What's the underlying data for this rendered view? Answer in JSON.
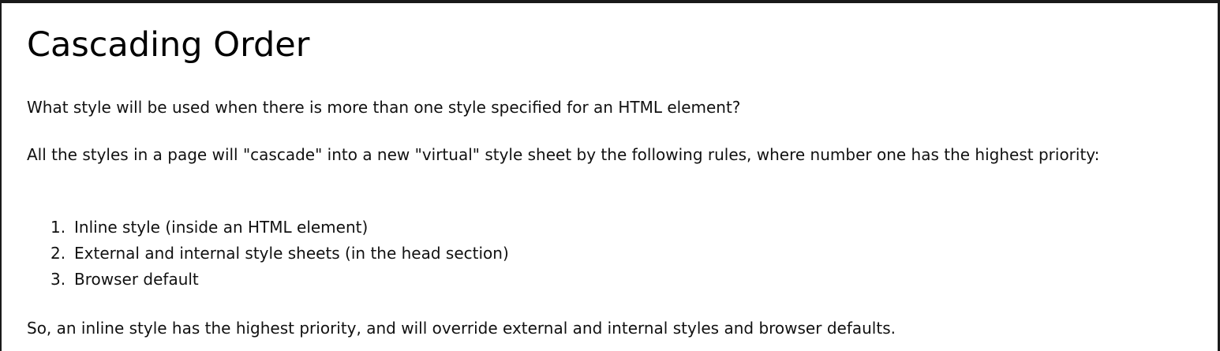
{
  "article": {
    "title": "Cascading Order",
    "question": "What style will be used when there is more than one style specified for an HTML element?",
    "intro": "All the styles in a page will \"cascade\" into a new \"virtual\" style sheet by the following rules, where number one has the highest priority:",
    "rules": [
      {
        "number": "1.",
        "text": "Inline style (inside an HTML element)"
      },
      {
        "number": "2.",
        "text": "External and internal style sheets (in the head section)"
      },
      {
        "number": "3.",
        "text": "Browser default"
      }
    ],
    "conclusion": "So, an inline style has the highest priority, and will override external and internal styles and browser defaults."
  }
}
